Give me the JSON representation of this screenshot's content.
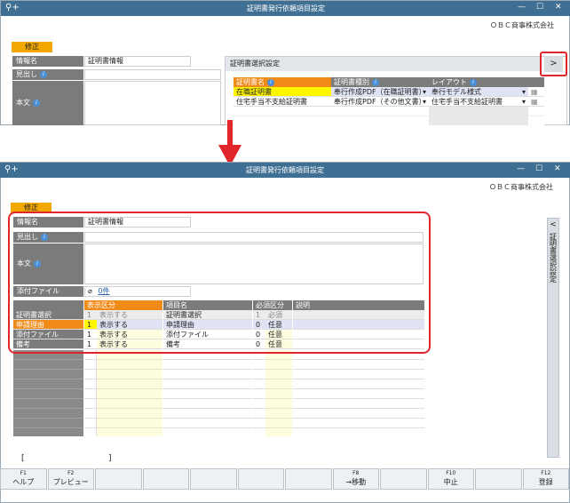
{
  "top": {
    "title": "証明書発行依頼項目設定",
    "company": "ＯＢＣ商事株式会社",
    "mode": "修正",
    "info_name_label": "情報名",
    "info_name_value": "証明書情報",
    "heading_label": "見出し",
    "body_label": "本文",
    "panel_title": "証明書選択設定",
    "panel_toggle": ">",
    "grid_headers": [
      "証明書名",
      "証明書種別",
      "レイアウト"
    ],
    "grid_rows": [
      {
        "name": "在職証明書",
        "kind": "奉行作成PDF（在職証明書）",
        "layout": "奉行モデル様式"
      },
      {
        "name": "住宅手当不支給証明書",
        "kind": "奉行作成PDF（その他文書）",
        "layout": "住宅手当不支給証明書"
      }
    ]
  },
  "bottom": {
    "title": "証明書発行依頼項目設定",
    "company": "ＯＢＣ商事株式会社",
    "mode": "修正",
    "info_name_label": "情報名",
    "info_name_value": "証明書情報",
    "heading_label": "見出し",
    "body_label": "本文",
    "attach_label": "添付ファイル",
    "attach_value": "0件",
    "side_panel_label": "証明書選択設定",
    "side_panel_chevron": "<",
    "grid_headers": {
      "display": "表示区分",
      "item": "項目名",
      "required": "必須区分",
      "desc": "説明"
    },
    "grid_rows": [
      {
        "label": "証明書選択",
        "d_no": "1",
        "d_text": "表示する",
        "item": "証明書選択",
        "r_no": "1",
        "r_text": "必須",
        "selected": false,
        "disabled": true
      },
      {
        "label": "申請理由",
        "d_no": "1",
        "d_text": "表示する",
        "item": "申請理由",
        "r_no": "0",
        "r_text": "任意",
        "selected": true,
        "disabled": false
      },
      {
        "label": "添付ファイル",
        "d_no": "1",
        "d_text": "表示する",
        "item": "添付ファイル",
        "r_no": "0",
        "r_text": "任意",
        "selected": false,
        "disabled": false
      },
      {
        "label": "備考",
        "d_no": "1",
        "d_text": "表示する",
        "item": "備考",
        "r_no": "0",
        "r_text": "任意",
        "selected": false,
        "disabled": false
      }
    ],
    "brackets": {
      "open": "[",
      "close": "]"
    },
    "fkeys": [
      {
        "key": "F1",
        "label": "ヘルプ"
      },
      {
        "key": "F2",
        "label": "プレビュー"
      },
      {
        "key": "",
        "label": ""
      },
      {
        "key": "",
        "label": ""
      },
      {
        "key": "",
        "label": ""
      },
      {
        "key": "",
        "label": ""
      },
      {
        "key": "",
        "label": ""
      },
      {
        "key": "F8",
        "label": "→移動"
      },
      {
        "key": "",
        "label": ""
      },
      {
        "key": "F10",
        "label": "中止"
      },
      {
        "key": "",
        "label": ""
      },
      {
        "key": "F12",
        "label": "登録"
      }
    ]
  },
  "colors": {
    "titlebar": "#3f6f92",
    "accent_orange": "#f08a18",
    "highlight_red": "#e0252b",
    "label_gray": "#7b7b7b",
    "yellow_cell": "#fffde0"
  }
}
